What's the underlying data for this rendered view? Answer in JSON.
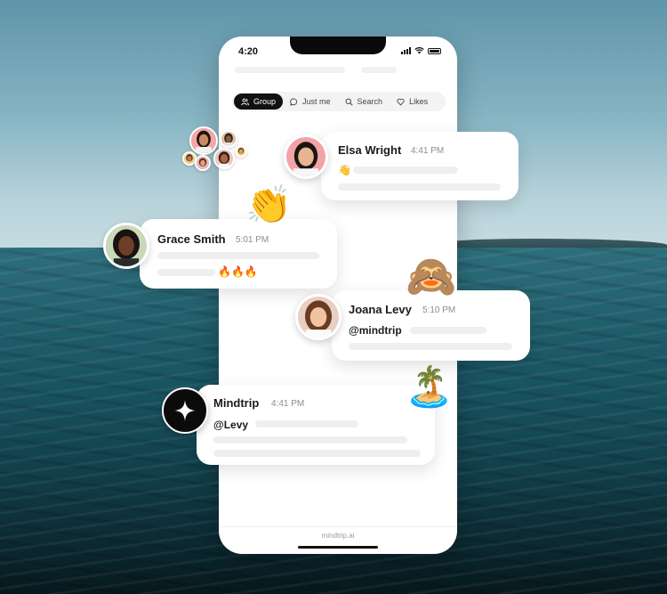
{
  "phone": {
    "status_time": "4:20",
    "tabs": [
      {
        "label": "Group",
        "icon": "group-icon",
        "active": true
      },
      {
        "label": "Just me",
        "icon": "chat-bubble-icon",
        "active": false
      },
      {
        "label": "Search",
        "icon": "search-icon",
        "active": false
      },
      {
        "label": "Likes",
        "icon": "heart-icon",
        "active": false
      }
    ],
    "footer_url": "mindtrip.ai"
  },
  "messages": [
    {
      "name": "Elsa Wright",
      "time": "4:41 PM",
      "emoji": "👋"
    },
    {
      "name": "Grace Smith",
      "time": "5:01 PM",
      "emoji": "🔥🔥🔥"
    },
    {
      "name": "Joana Levy",
      "time": "5:10 PM",
      "mention": "@mindtrip"
    },
    {
      "name": "Mindtrip",
      "time": "4:41 PM",
      "mention": "@Levy"
    }
  ],
  "floating_emojis": {
    "clap": "👏",
    "see_no_evil": "🙈",
    "island": "🏝️"
  },
  "colors": {
    "accent": "#111111",
    "card_bg": "#ffffff",
    "placeholder": "#efefef"
  }
}
